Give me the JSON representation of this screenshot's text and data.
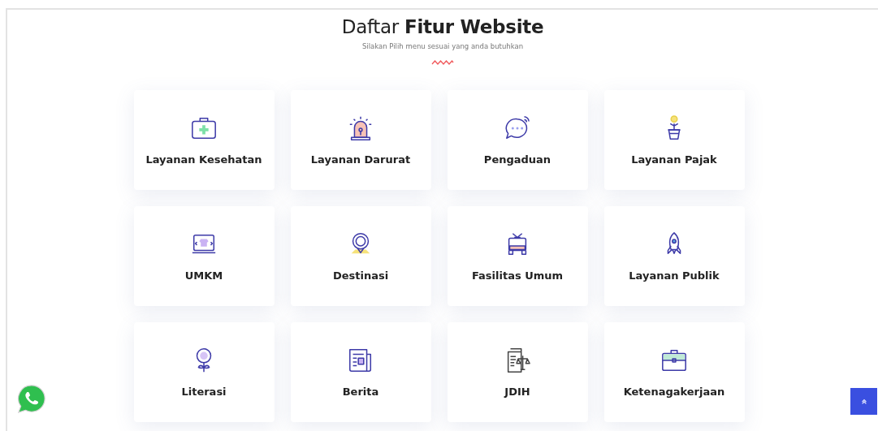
{
  "heading": {
    "title": "Daftar **Fitur Website**",
    "subtitle": "Silakan Pilih menu sesuai yang anda butuhkan"
  },
  "features": [
    {
      "label": "Layanan Kesehatan",
      "kind": "medical"
    },
    {
      "label": "Layanan Darurat",
      "kind": "siren"
    },
    {
      "label": "Pengaduan",
      "kind": "chat"
    },
    {
      "label": "Layanan Pajak",
      "kind": "plant"
    },
    {
      "label": "UMKM",
      "kind": "laptop"
    },
    {
      "label": "Destinasi",
      "kind": "pin"
    },
    {
      "label": "Fasilitas Umum",
      "kind": "vehicle"
    },
    {
      "label": "Layanan Publik",
      "kind": "rocket"
    },
    {
      "label": "Literasi",
      "kind": "flower"
    },
    {
      "label": "Berita",
      "kind": "news"
    },
    {
      "label": "JDIH",
      "kind": "law"
    },
    {
      "label": "Ketenagakerjaan",
      "kind": "briefcase"
    }
  ]
}
